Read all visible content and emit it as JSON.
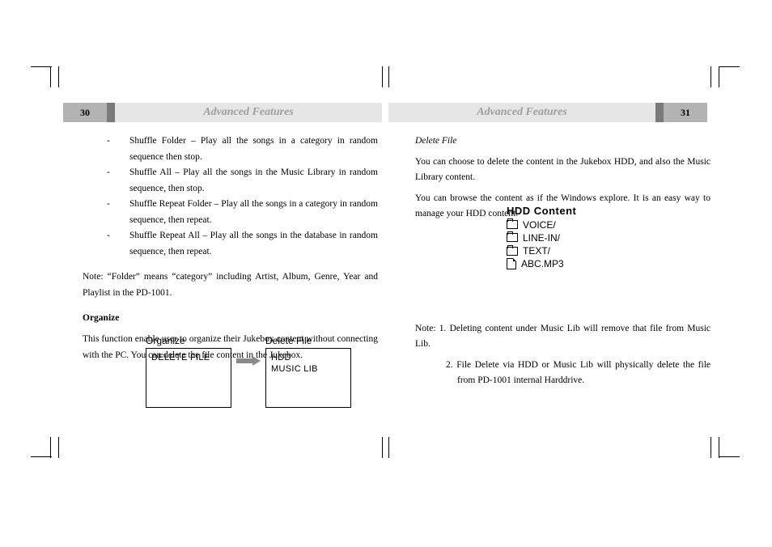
{
  "header": {
    "left_page_num": "30",
    "right_page_num": "31",
    "title_left": "Advanced Features",
    "title_right": "Advanced Features"
  },
  "left": {
    "bullets": [
      "Shuffle Folder – Play all the songs in a category in random sequence then stop.",
      "Shuffle All – Play all the songs in the Music Library in random sequence, then stop.",
      "Shuffle Repeat Folder – Play all the songs in a category in random sequence, then repeat.",
      "Shuffle Repeat All – Play all the songs in the database in random sequence, then repeat."
    ],
    "note": "Note: “Folder” means “category” including Artist, Album, Genre, Year and Playlist in the PD-1001.",
    "organize_heading": "Organize",
    "organize_body": "This function enable user to organize their Jukebox content without connecting with the PC. You can delete the file content in the Jukebox.",
    "diagram": {
      "box1_title": "Organize",
      "box1_item": "DELETE FILE",
      "box2_title": "Delete File",
      "box2_item1": "HDD",
      "box2_item2": "MUSIC LIB"
    }
  },
  "right": {
    "delete_heading": "Delete File",
    "delete_p1": "You can choose to delete the content in the Jukebox HDD, and also the Music Library content.",
    "delete_p2": "You can browse the content as if the Windows explore. It is an easy way to manage your HDD content.",
    "hdd": {
      "title": "HDD Content",
      "items": [
        "VOICE/",
        "LINE-IN/",
        "TEXT/",
        "ABC.MP3"
      ]
    },
    "note1": "Note: 1. Deleting content under Music Lib will remove that file from Music Lib.",
    "note2": "2. File Delete via HDD or Music Lib will physically delete the file from PD-1001 internal Harddrive."
  }
}
